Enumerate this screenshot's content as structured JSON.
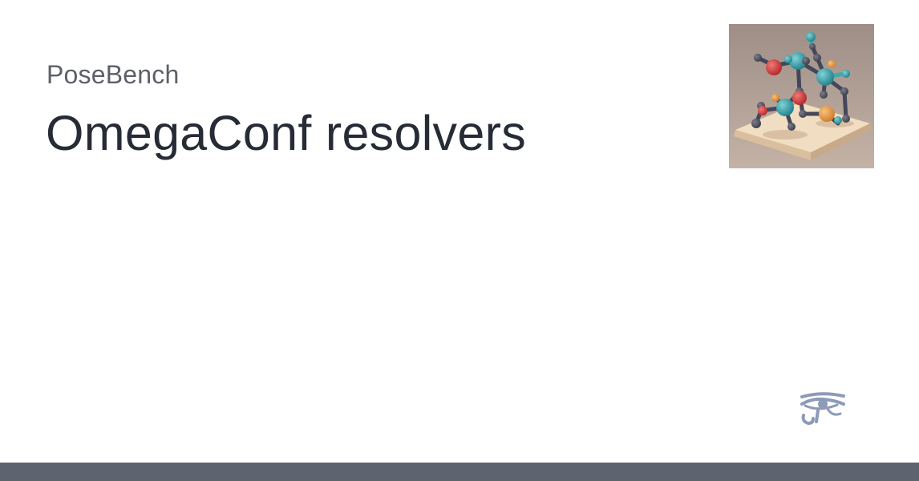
{
  "card": {
    "site_name": "PoseBench",
    "title": "OmegaConf resolvers",
    "logo_icon": "molecule-logo",
    "brand_icon": "eye-of-horus-icon"
  },
  "colors": {
    "background": "#ffffff",
    "site_name": "#5d6069",
    "title": "#262b35",
    "bottom_bar": "#5d6470",
    "brand_icon": "#8d9ab8"
  }
}
